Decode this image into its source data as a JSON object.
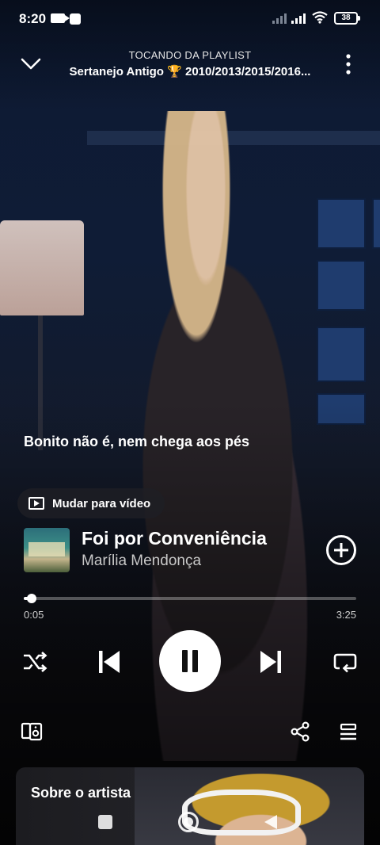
{
  "status_bar": {
    "time": "8:20",
    "battery": "38"
  },
  "header": {
    "subtitle": "TOCANDO DA PLAYLIST",
    "playlist_title": "Sertanejo Antigo 🏆 2010/2013/2015/2016..."
  },
  "lyric": {
    "line": "Bonito não é, nem chega aos pés"
  },
  "video_toggle": {
    "label": "Mudar para vídeo"
  },
  "track": {
    "title": "Foi por Conveniência",
    "artist": "Marília Mendonça"
  },
  "progress": {
    "current": "0:05",
    "total": "3:25",
    "fraction": 0.024
  },
  "artist_card": {
    "label": "Sobre o artista"
  },
  "icons": {
    "header_left": "chevron-down-icon",
    "header_right": "more-vertical-icon",
    "shuffle": "shuffle-icon",
    "previous": "skip-previous-icon",
    "play_pause": "pause-icon",
    "next": "skip-next-icon",
    "repeat": "repeat-icon",
    "devices": "connect-device-icon",
    "share": "share-icon",
    "queue": "queue-icon",
    "add": "add-circle-icon"
  },
  "colors": {
    "accent": "#ffffff",
    "secondary_text": "#c8c8c8"
  }
}
